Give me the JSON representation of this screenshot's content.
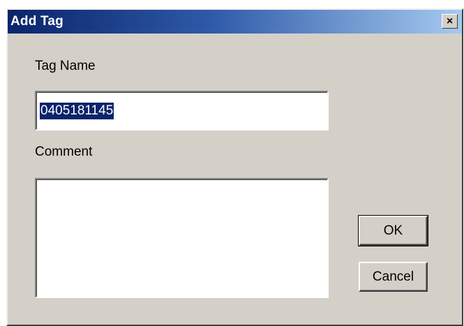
{
  "dialog": {
    "title": "Add Tag",
    "close_label": "×"
  },
  "tag_name": {
    "label": "Tag Name",
    "value": "0405181145"
  },
  "comment": {
    "label": "Comment",
    "value": ""
  },
  "buttons": {
    "ok": "OK",
    "cancel": "Cancel"
  },
  "colors": {
    "titlebar_start": "#0a246a",
    "titlebar_end": "#a6caf0",
    "dialog_face": "#d4d0c8",
    "selection": "#0a246a"
  }
}
